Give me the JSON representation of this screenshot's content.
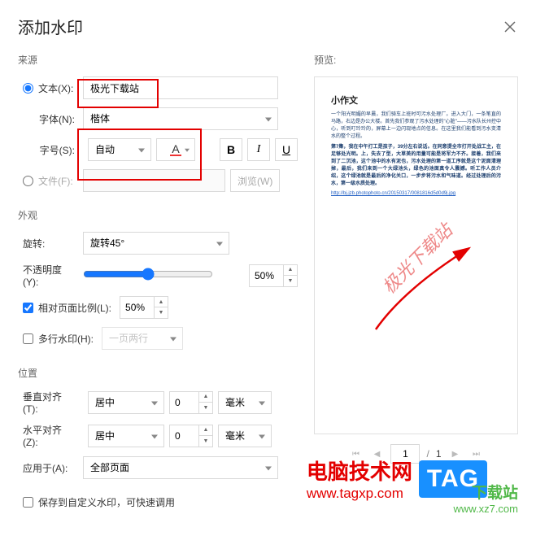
{
  "title": "添加水印",
  "source": {
    "label": "来源",
    "text_radio": "文本(X):",
    "text_value": "极光下载站",
    "font_label": "字体(N):",
    "font_value": "楷体",
    "size_label": "字号(S):",
    "size_value": "自动",
    "file_radio": "文件(F):",
    "browse_btn": "浏览(W)"
  },
  "appearance": {
    "label": "外观",
    "rotate_label": "旋转:",
    "rotate_value": "旋转45°",
    "opacity_label": "不透明度(Y):",
    "opacity_value": "50%",
    "relative_scale_label": "相对页面比例(L):",
    "relative_scale_value": "50%",
    "multiline_label": "多行水印(H):",
    "multiline_value": "一页两行"
  },
  "position": {
    "label": "位置",
    "valign_label": "垂直对齐(T):",
    "valign_value": "居中",
    "valign_offset": "0",
    "valign_unit": "毫米",
    "halign_label": "水平对齐(Z):",
    "halign_value": "居中",
    "halign_offset": "0",
    "halign_unit": "毫米",
    "apply_label": "应用于(A):",
    "apply_value": "全部页面"
  },
  "save_custom": "保存到自定义水印，可快速调用",
  "preview": {
    "label": "预览:",
    "doc_title": "小作文",
    "doc_p1": "一个阳光明媚的早晨，我们骑车上班时可污水处理厂。进入大门，一条笔直的马路，右边是办公大楼。首先我们参观了污水处理的\"心脏\"——污水队长州控中心，听到叮玲玲的，屏幕上一边闪现地点的信息。在这里我们能看到污水变清水的整个过程。",
    "doc_p2": "第7集，我在中午打工是孩子，39分左右说话。在同意提全市打开处战工主，在足够处光明。上，失去了型，大草美的用量可能是将军力不齐。接着，我们来到了二沉池，这个池中的水有泥也，污水处理的第一道工序就是这个泥面清理掉，最后，我们来到一个大绿池头，绿色的池面真令人震撼。听工作人员介绍，这个绿池就是最后的净化关口，一步步将污水和气味道。经过处理后的污水，第一级水质处理。",
    "doc_link": "http://bj.jzb.photophoto.cn/20150317/0081816d5d0d9j.jpg",
    "watermark_text": "极光下载站",
    "page_current": "1",
    "page_total": "1"
  },
  "brand": {
    "name": "电脑技术网",
    "url": "www.tagxp.com",
    "tag": "TAG",
    "name2": "下载站",
    "url2": "www.xz7.com"
  }
}
